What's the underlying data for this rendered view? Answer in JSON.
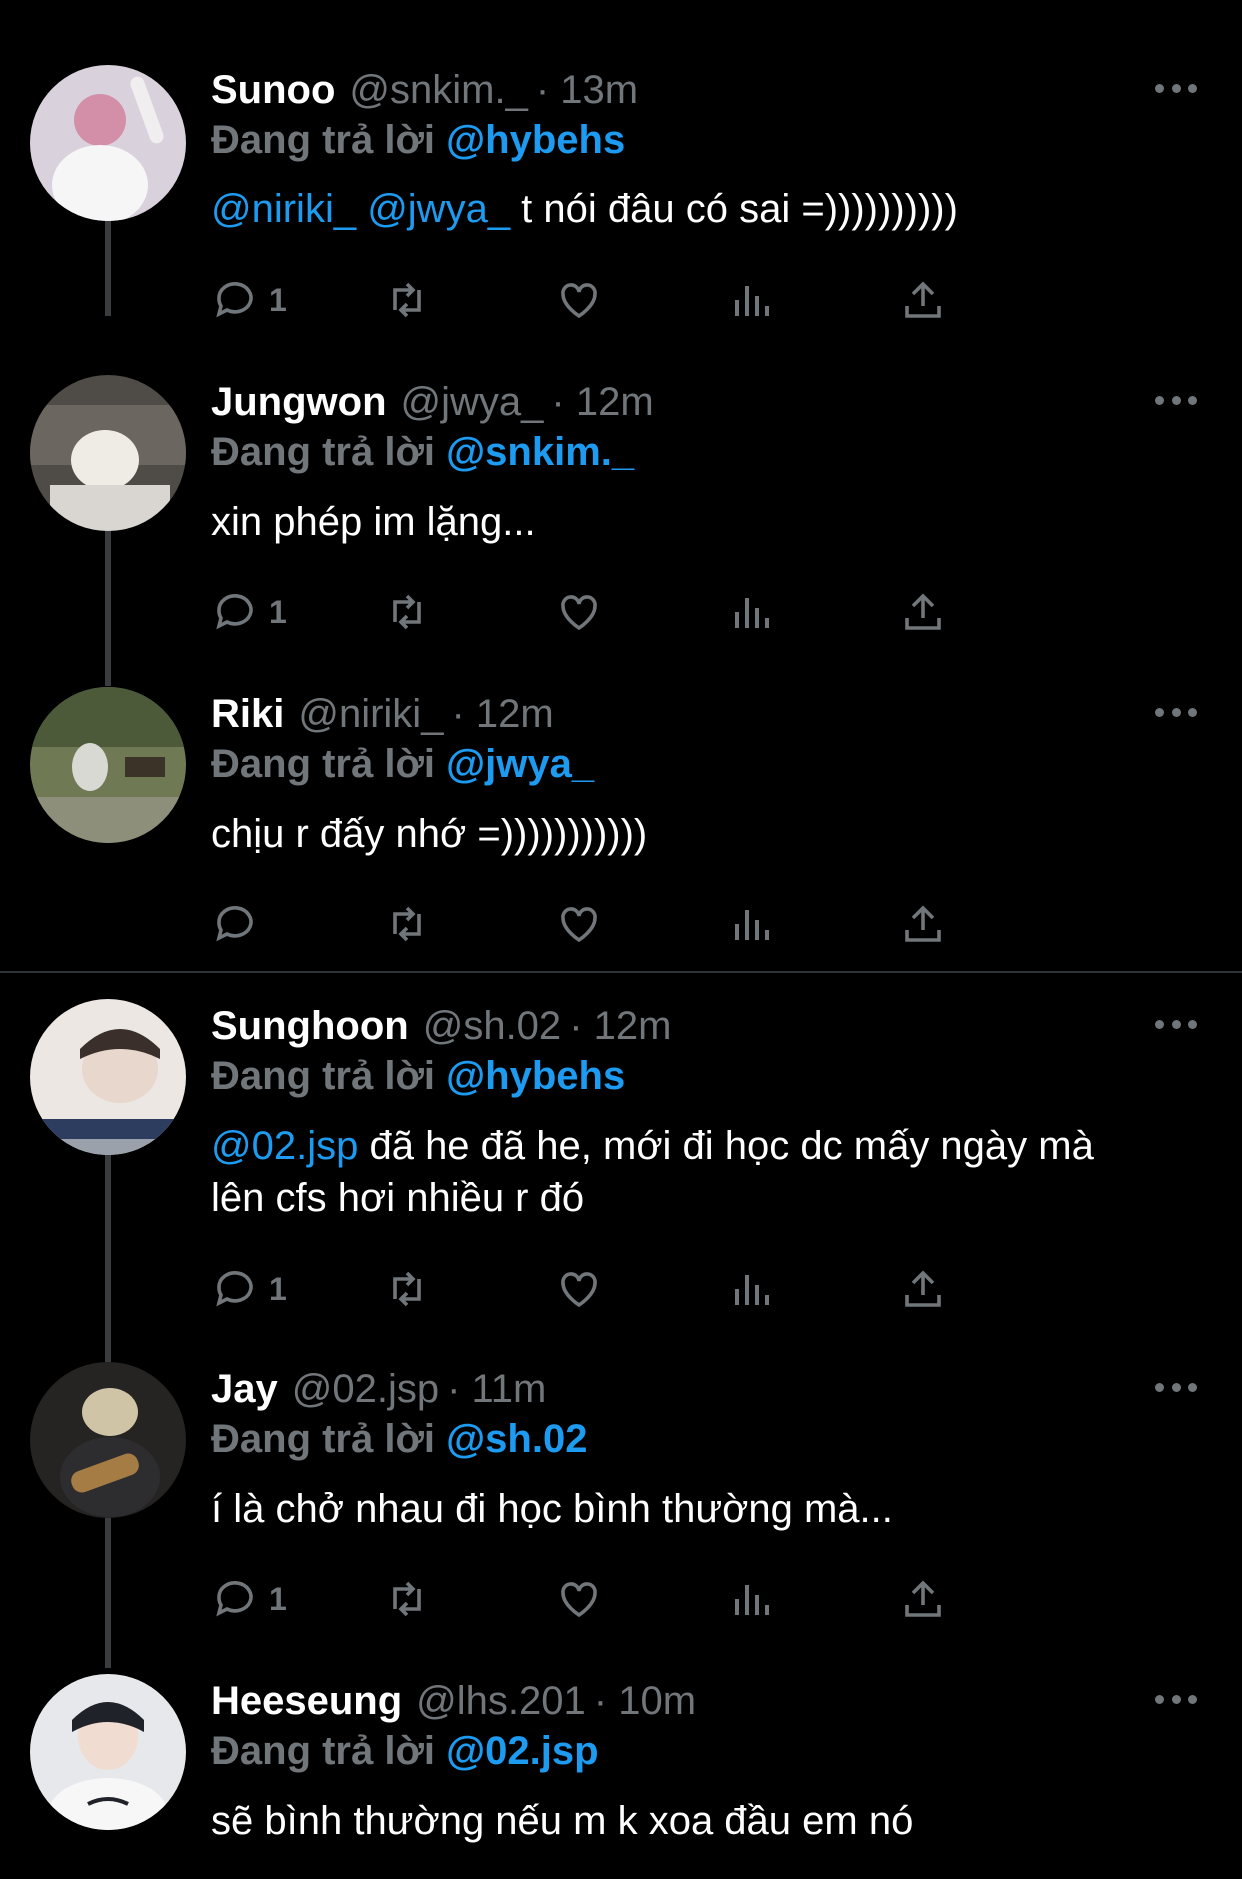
{
  "replying_label": "Đang trả lời",
  "tweets": [
    {
      "name": "Sunoo",
      "handle": "@snkim._",
      "time": "· 13m",
      "reply_to": "@hybehs",
      "mentions": "@niriki_ @jwya_",
      "text": " t nói đâu có sai =))))))))))",
      "reply_count": "1",
      "avatar_colors": [
        "#c9b8c9",
        "#f1eef0"
      ]
    },
    {
      "name": "Jungwon",
      "handle": "@jwya_",
      "time": "· 12m",
      "reply_to": "@snkim._",
      "mentions": "",
      "text": "xin phép im lặng...",
      "reply_count": "1",
      "avatar_colors": [
        "#5a554e",
        "#e9e4dc"
      ]
    },
    {
      "name": "Riki",
      "handle": "@niriki_",
      "time": "· 12m",
      "reply_to": "@jwya_",
      "mentions": "",
      "text": "chịu r đấy nhớ =)))))))))))",
      "reply_count": "",
      "avatar_colors": [
        "#5d6b4a",
        "#9aa27d"
      ]
    },
    {
      "name": "Sunghoon",
      "handle": "@sh.02",
      "time": "· 12m",
      "reply_to": "@hybehs",
      "mentions": "@02.jsp",
      "text": " đã he đã he, mới đi học dc mấy ngày mà lên cfs hơi nhiều r đó",
      "reply_count": "1",
      "avatar_colors": [
        "#d8cfc8",
        "#f6f1ee"
      ]
    },
    {
      "name": "Jay",
      "handle": "@02.jsp",
      "time": "· 11m",
      "reply_to": "@sh.02",
      "mentions": "",
      "text": "í là chở nhau đi học bình thường mà...",
      "reply_count": "1",
      "avatar_colors": [
        "#2b2a29",
        "#c9b68a"
      ]
    },
    {
      "name": "Heeseung",
      "handle": "@lhs.201",
      "time": "· 10m",
      "reply_to": "@02.jsp",
      "mentions": "",
      "text": "sẽ bình thường nếu m k xoa đầu em nó",
      "reply_count": "",
      "avatar_colors": [
        "#dfe3ea",
        "#2a2f3a"
      ]
    }
  ],
  "colors": {
    "background": "#000000",
    "accent": "#1d9bf0",
    "muted": "#71767b",
    "text": "#ffffff"
  }
}
